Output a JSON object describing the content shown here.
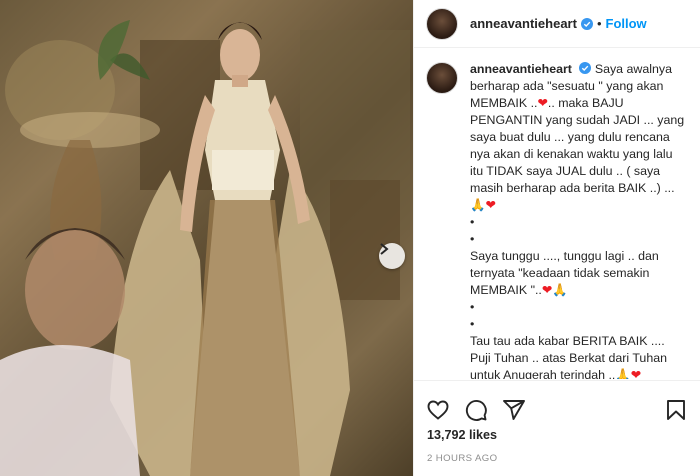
{
  "post": {
    "author": "anneavantieheart",
    "follow_label": "Follow",
    "separator": "•"
  },
  "caption": {
    "username": "anneavantieheart",
    "paragraphs": [
      "Saya awalnya berharap ada \"sesuatu \" yang akan MEMBAIK ..",
      ".. maka BAJU PENGANTIN yang sudah JADI ... yang saya buat dulu ... yang dulu rencana nya akan di kenakan waktu yang lalu itu TIDAK saya JUAL dulu .. ( saya masih berharap ada berita BAIK ..) ...",
      "Saya tunggu ...., tunggu lagi .. dan ternyata \"keadaan tidak semakin MEMBAIK \"..",
      "Tau tau ada kabar BERITA BAIK .... Puji Tuhan .. atas Berkat dari Tuhan untuk Anugerah terindah .."
    ],
    "bullet": "•",
    "heart": "❤",
    "pray": "🙏"
  },
  "stats": {
    "likes": "13,792 likes",
    "posted": "2 HOURS AGO"
  },
  "icons": [
    "verified-badge-icon",
    "heart-icon",
    "comment-icon",
    "share-icon",
    "bookmark-icon",
    "next-arrow-icon"
  ],
  "colors": {
    "accent": "#0095f6",
    "text": "#262626",
    "muted": "#8e8e8e",
    "heart": "#ed1c24"
  }
}
